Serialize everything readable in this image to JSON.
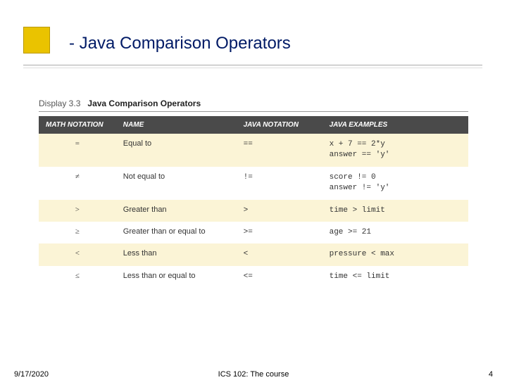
{
  "title": "- Java Comparison Operators",
  "caption_prefix": "Display 3.3",
  "caption_title": "Java Comparison Operators",
  "header": {
    "math": "MATH NOTATION",
    "name": "NAME",
    "java": "JAVA NOTATION",
    "examples": "JAVA EXAMPLES"
  },
  "rows": [
    {
      "math": "=",
      "name": "Equal to",
      "java": "==",
      "examples": "x + 7 == 2*y\nanswer == 'y'"
    },
    {
      "math": "≠",
      "name": "Not equal to",
      "java": "!=",
      "examples": "score != 0\nanswer != 'y'"
    },
    {
      "math": ">",
      "name": "Greater than",
      "java": ">",
      "examples": "time > limit"
    },
    {
      "math": "≥",
      "name": "Greater than or equal to",
      "java": ">=",
      "examples": "age >= 21"
    },
    {
      "math": "<",
      "name": "Less than",
      "java": "<",
      "examples": "pressure < max"
    },
    {
      "math": "≤",
      "name": "Less than or equal to",
      "java": "<=",
      "examples": "time <= limit"
    }
  ],
  "footer": {
    "date": "9/17/2020",
    "course": "ICS 102: The course",
    "page": "4"
  }
}
